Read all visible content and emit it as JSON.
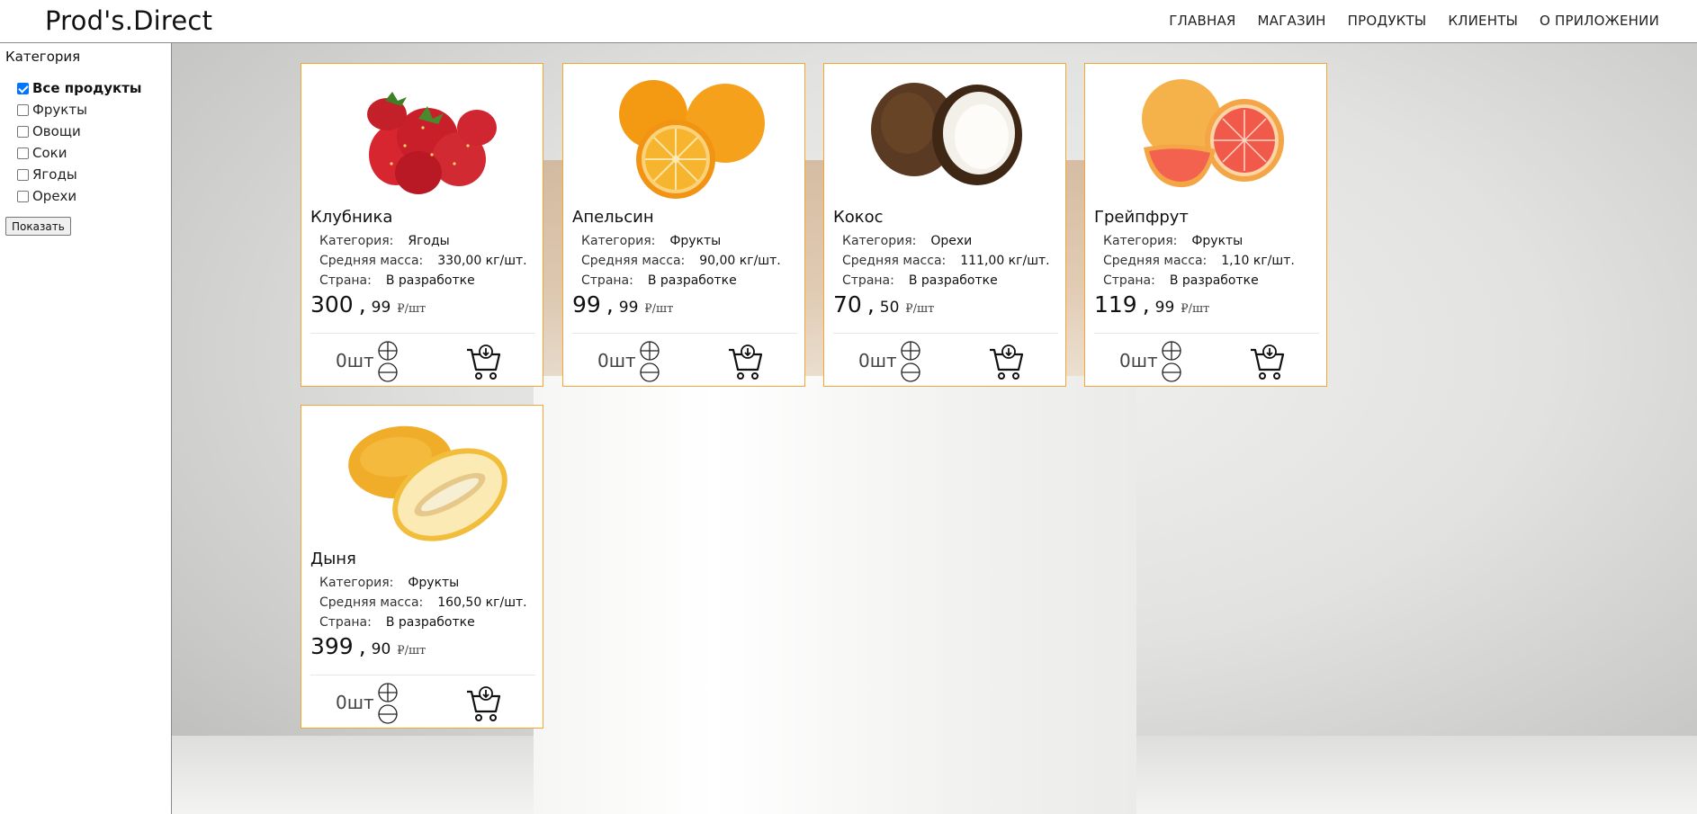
{
  "header": {
    "logo": "Prod's.Direct",
    "nav": [
      "ГЛАВНАЯ",
      "МАГАЗИН",
      "ПРОДУКТЫ",
      "КЛИЕНТЫ",
      "О ПРИЛОЖЕНИИ"
    ]
  },
  "sidebar": {
    "title": "Категория",
    "filters": [
      {
        "label": "Все продукты",
        "checked": true
      },
      {
        "label": "Фрукты",
        "checked": false
      },
      {
        "label": "Овощи",
        "checked": false
      },
      {
        "label": "Соки",
        "checked": false
      },
      {
        "label": "Ягоды",
        "checked": false
      },
      {
        "label": "Орехи",
        "checked": false
      }
    ],
    "button": "Показать"
  },
  "labels": {
    "category": "Категория:",
    "mass": "Средняя масса:",
    "country": "Страна:",
    "unit": "₽/шт",
    "qty_suffix": "шт"
  },
  "products": [
    {
      "name": "Клубника",
      "category": "Ягоды",
      "mass": "330,00 кг/шт.",
      "country": "В разработке",
      "price_int": "300",
      "price_frac": "99",
      "qty": "0",
      "image": "strawberry-image"
    },
    {
      "name": "Апельсин",
      "category": "Фрукты",
      "mass": "90,00 кг/шт.",
      "country": "В разработке",
      "price_int": "99",
      "price_frac": "99",
      "qty": "0",
      "image": "orange-image"
    },
    {
      "name": "Кокос",
      "category": "Орехи",
      "mass": "111,00 кг/шт.",
      "country": "В разработке",
      "price_int": "70",
      "price_frac": "50",
      "qty": "0",
      "image": "coconut-image"
    },
    {
      "name": "Грейпфрут",
      "category": "Фрукты",
      "mass": "1,10 кг/шт.",
      "country": "В разработке",
      "price_int": "119",
      "price_frac": "99",
      "qty": "0",
      "image": "grapefruit-image"
    },
    {
      "name": "Дыня",
      "category": "Фрукты",
      "mass": "160,50 кг/шт.",
      "country": "В разработке",
      "price_int": "399",
      "price_frac": "90",
      "qty": "0",
      "image": "melon-image"
    }
  ],
  "colors": {
    "card_border": "#f5a531",
    "checkbox": "#0075ff"
  }
}
